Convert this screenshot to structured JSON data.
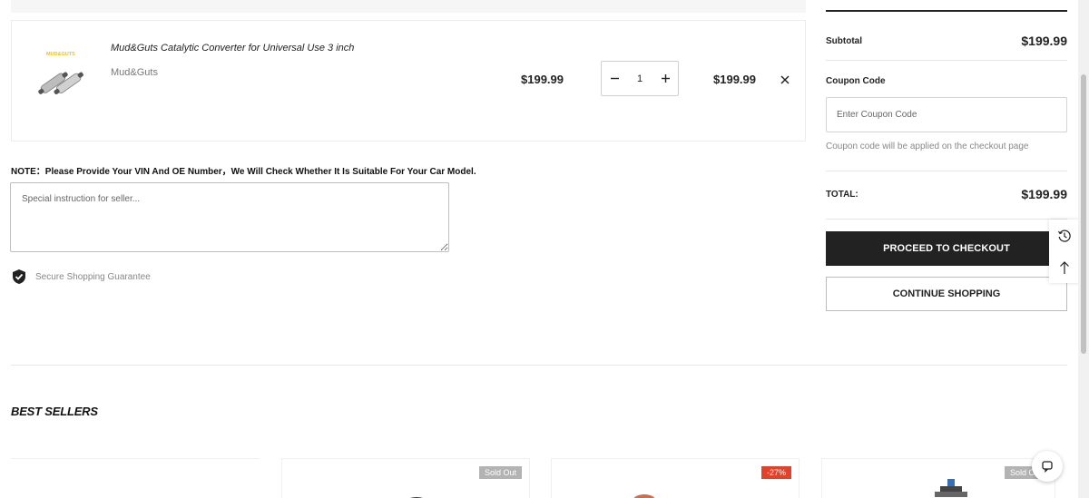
{
  "cart": {
    "item": {
      "title": "Mud&Guts Catalytic Converter for Universal Use 3 inch",
      "vendor": "Mud&Guts",
      "thumb_logo": "MUD&GUTS",
      "unit_price": "$199.99",
      "quantity": "1",
      "line_total": "$199.99"
    },
    "note_label": "NOTE：Please Provide Your VIN And OE Number，We Will Check Whether It Is Suitable For Your Car Model.",
    "note_placeholder": "Special instruction for seller...",
    "secure_text": "Secure Shopping Guarantee"
  },
  "summary": {
    "subtotal_label": "Subtotal",
    "subtotal_value": "$199.99",
    "coupon_label": "Coupon Code",
    "coupon_placeholder": "Enter Coupon Code",
    "coupon_note": "Coupon code will be applied on the checkout page",
    "total_label": "TOTAL:",
    "total_value": "$199.99",
    "checkout_label": "PROCEED TO CHECKOUT",
    "continue_label": "CONTINUE SHOPPING"
  },
  "best_sellers": {
    "title": "BEST SELLERS",
    "badges": [
      {
        "text": "Sold Out",
        "color": "#b3b3b3"
      },
      {
        "text": "-27%",
        "color": "#e0432b"
      },
      {
        "text": "Sold Out",
        "color": "#b3b3b3"
      }
    ]
  },
  "icons": {
    "check": "shield-check-icon",
    "remove": "close-icon",
    "history": "history-icon",
    "to_top": "arrow-up-icon",
    "chat": "chat-icon"
  },
  "colors": {
    "dark": "#222222",
    "brand_logo": "#e6c229"
  }
}
